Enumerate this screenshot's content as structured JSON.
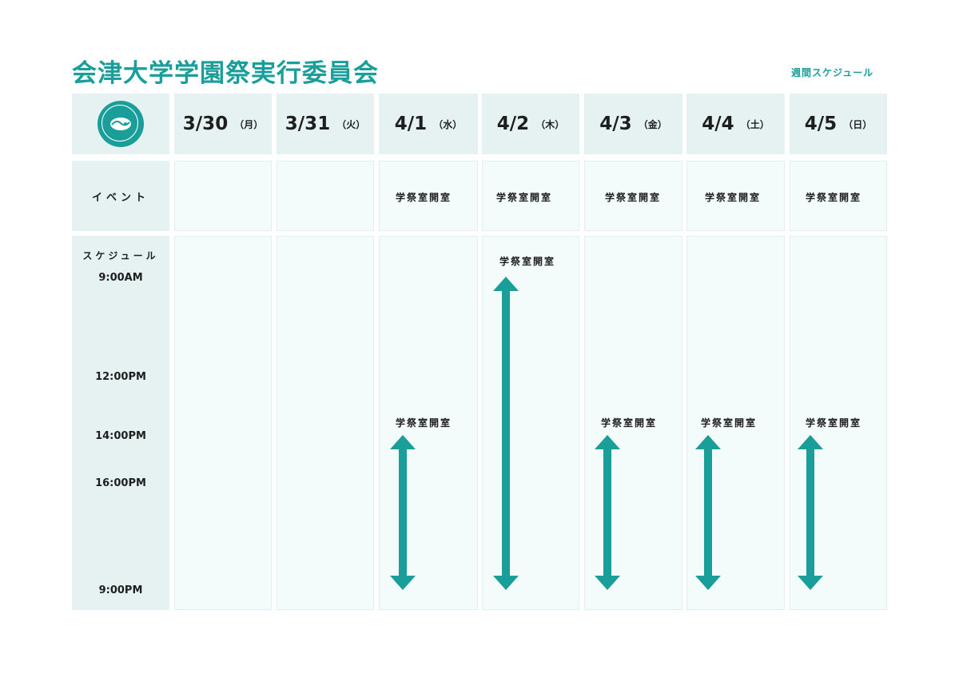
{
  "header": {
    "title": "会津大学学園祭実行委員会",
    "subtitle": "週間スケジュール"
  },
  "logo": {
    "icon": "university-seal-icon"
  },
  "days": [
    {
      "date": "3/30",
      "weekday": "（月）",
      "event": "",
      "schedule": ""
    },
    {
      "date": "3/31",
      "weekday": "（火）",
      "event": "",
      "schedule": ""
    },
    {
      "date": "4/1",
      "weekday": "（水）",
      "event": "学祭室開室",
      "schedule": "学祭室開室",
      "start": "14:00",
      "end": "21:00"
    },
    {
      "date": "4/2",
      "weekday": "（木）",
      "event": "学祭室開室",
      "schedule": "学祭室開室",
      "start": "9:00",
      "end": "21:00"
    },
    {
      "date": "4/3",
      "weekday": "（金）",
      "event": "学祭室開室",
      "schedule": "学祭室開室",
      "start": "14:00",
      "end": "21:00"
    },
    {
      "date": "4/4",
      "weekday": "（土）",
      "event": "学祭室開室",
      "schedule": "学祭室開室",
      "start": "14:00",
      "end": "21:00"
    },
    {
      "date": "4/5",
      "weekday": "（日）",
      "event": "学祭室開室",
      "schedule": "学祭室開室",
      "start": "14:00",
      "end": "21:00"
    }
  ],
  "rows": {
    "event_label": "イベント",
    "schedule_label": "スケジュール"
  },
  "times": [
    "9:00AM",
    "12:00PM",
    "14:00PM",
    "16:00PM",
    "9:00PM"
  ],
  "colors": {
    "accent": "#1a9e9a",
    "header_bg": "#e6f2f2",
    "cell_bg": "#f4fbfb"
  }
}
